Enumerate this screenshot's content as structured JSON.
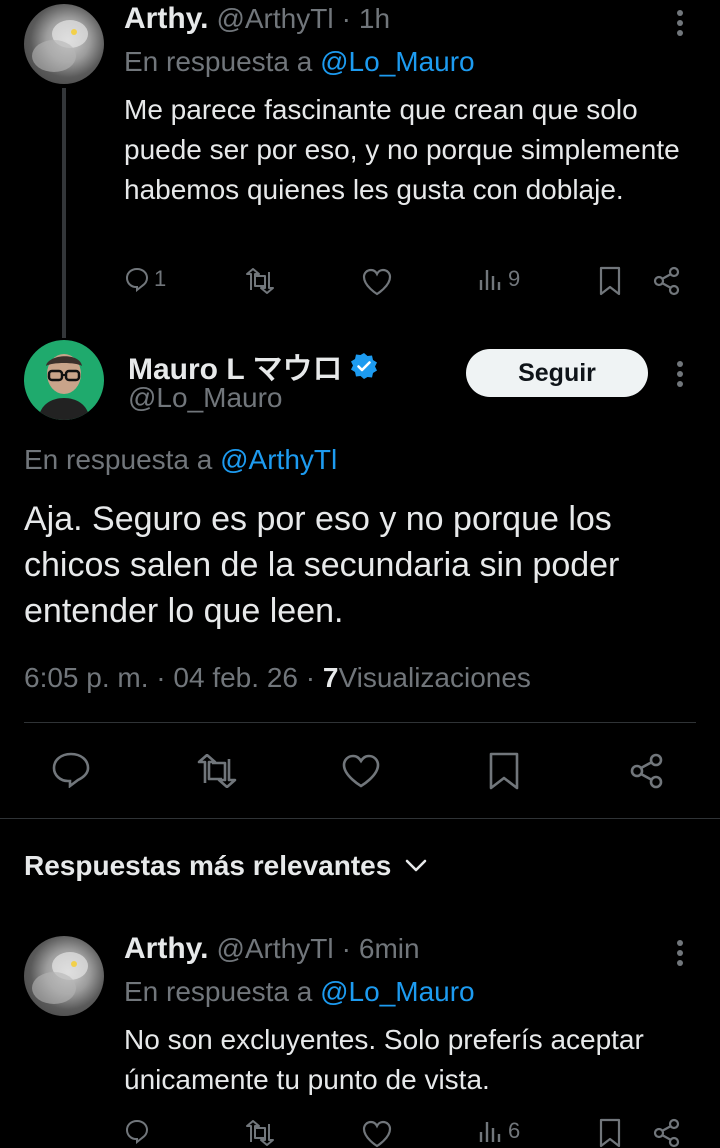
{
  "reply_top": {
    "name": "Arthy.",
    "handle": "@ArthyTl",
    "sep": "·",
    "time": "1h",
    "reply_prefix": "En respuesta a",
    "reply_to": "@Lo_Mauro",
    "text": "Me parece fascinante que crean que solo puede ser por eso, y no porque simplemente habemos quienes les gusta con doblaje.",
    "replies": "1",
    "views": "9"
  },
  "main_tweet": {
    "name": "Mauro L マウロ",
    "handle": "@Lo_Mauro",
    "follow_label": "Seguir",
    "reply_prefix": "En respuesta a",
    "reply_to": "@ArthyTl",
    "text": "Aja. Seguro es por eso y no porque los chicos salen de la secundaria sin poder entender lo que leen.",
    "time": "6:05 p. m.",
    "sep1": "·",
    "date": "04 feb. 26",
    "sep2": "·",
    "views_count": "7",
    "views_label": "Visualizaciones"
  },
  "replies_header": {
    "label": "Respuestas más relevantes"
  },
  "reply_bottom": {
    "name": "Arthy.",
    "handle": "@ArthyTl",
    "sep": "·",
    "time": "6min",
    "reply_prefix": "En respuesta a",
    "reply_to": "@Lo_Mauro",
    "text": "No son excluyentes. Solo preferís aceptar únicamente tu punto de vista.",
    "views": "6"
  },
  "colors": {
    "background": "#000000",
    "text": "#e7e9ea",
    "muted": "#71767b",
    "link": "#1d9bf0",
    "verified": "#1d9bf0"
  },
  "icons": [
    "more-icon",
    "reply-icon",
    "retweet-icon",
    "like-icon",
    "views-icon",
    "bookmark-icon",
    "share-icon",
    "verified-badge-icon",
    "chevron-down-icon"
  ]
}
